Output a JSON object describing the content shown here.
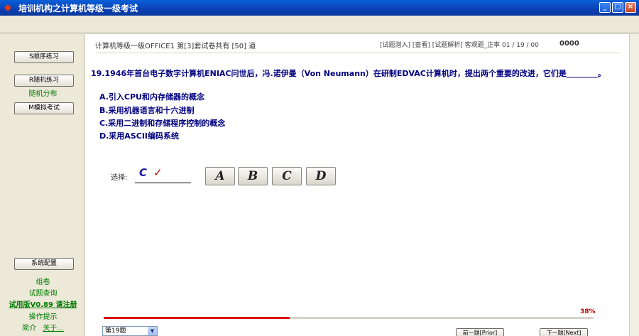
{
  "window": {
    "title": "培训机构之计算机等级一级考试",
    "min": "_",
    "max": "□",
    "close": "×"
  },
  "sidebar": {
    "buttons": [
      "S顺序练习",
      "R随机练习",
      "M模拟考试",
      "系统配置"
    ],
    "random_note": "随机分布",
    "links": [
      "组卷",
      "试题查询",
      "操作提示"
    ],
    "trial": "试用版V0.89 请注册",
    "about_label": "简介",
    "about_link": "关于..."
  },
  "header": {
    "info": "计算机等级一级OFFICE1 第[3]套试卷共有 [50] 道",
    "right": "[试题潜入] [查看] [试题解析] 客观题_正率 01 / 19 / 00",
    "score": "0000"
  },
  "question": {
    "text": "19.1946年首台电子数字计算机ENIAC问世后，冯.诺伊曼（Von Neumann）在研制EDVAC计算机时，提出两个重要的改进，它们是________。",
    "options": [
      "A.引入CPU和内存储器的概念",
      "B.采用机器语言和十六进制",
      "C.采用二进制和存储程序控制的概念",
      "D.采用ASCII编码系统"
    ]
  },
  "answer": {
    "label": "选择:",
    "selected": "C",
    "check": "✓",
    "buttons": [
      "A",
      "B",
      "C",
      "D"
    ]
  },
  "progress": {
    "percent": 38,
    "label": "38%"
  },
  "footer": {
    "question_select": "第19题",
    "prev": "前一题[Prior]",
    "next": "下一题[Next]"
  },
  "colors": {
    "accent": "#000080",
    "progress": "#d40000",
    "sidebar_text": "#007a00"
  }
}
